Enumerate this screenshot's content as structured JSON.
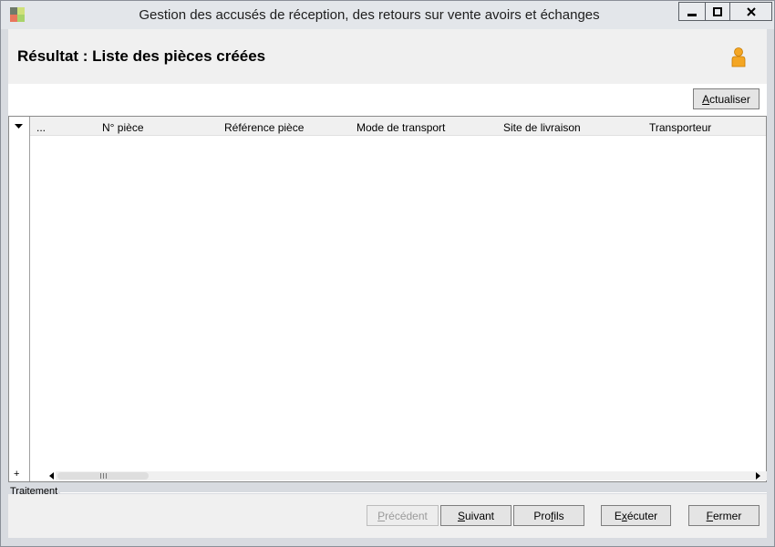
{
  "window": {
    "title": "Gestion des accusés de réception, des retours sur vente avoirs et échanges"
  },
  "header": {
    "title": "Résultat : Liste des pièces créées"
  },
  "toolbar": {
    "refresh_label": "Actualiser",
    "refresh_accel": "A",
    "refresh_rest": "ctualiser"
  },
  "grid": {
    "columns": [
      "...",
      "N° pièce",
      "Référence pièce",
      "Mode de transport",
      "Site de livraison",
      "Transporteur"
    ],
    "rows": [],
    "add_symbol": "+"
  },
  "footer": {
    "group_label": "Traitement",
    "prev": {
      "accel": "P",
      "rest": "récédent"
    },
    "next": {
      "accel": "S",
      "rest": "uivant"
    },
    "profiles": {
      "pre": "Pro",
      "accel": "f",
      "rest": "ils"
    },
    "execute": {
      "pre": "E",
      "accel": "x",
      "rest": "écuter"
    },
    "close": {
      "accel": "F",
      "rest": "ermer"
    }
  },
  "colors": {
    "window_bg": "#d8dbe0",
    "header_bg": "#f0f0f0",
    "button_bg": "#e4e4e4"
  },
  "icons": {
    "app": "app-tiles-icon",
    "user": "user-icon",
    "minimize": "minimize-icon",
    "maximize": "maximize-icon",
    "close": "close-icon",
    "column_menu": "column-dropdown-icon",
    "scroll_left": "scroll-left-icon",
    "scroll_right": "scroll-right-icon"
  }
}
